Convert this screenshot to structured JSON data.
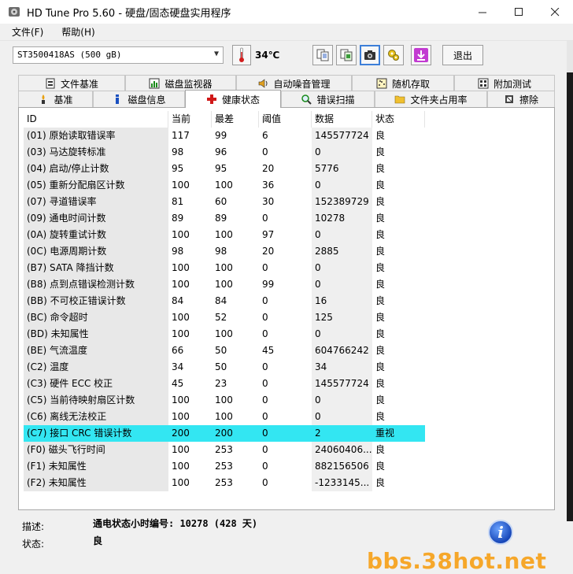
{
  "window": {
    "title": "HD Tune Pro 5.60 - 硬盘/固态硬盘实用程序",
    "minimize_icon": "minimize-icon",
    "maximize_icon": "maximize-icon",
    "close_icon": "close-icon"
  },
  "menu": [
    {
      "label": "文件(F)"
    },
    {
      "label": "帮助(H)"
    }
  ],
  "toolbar": {
    "drive": "ST3500418AS (500 gB)",
    "temperature": "34℃",
    "exit_label": "退出"
  },
  "tabs_top": [
    {
      "label": "文件基准",
      "icon": "file-benchmark-icon"
    },
    {
      "label": "磁盘监视器",
      "icon": "disk-monitor-icon"
    },
    {
      "label": "自动噪音管理",
      "icon": "speaker-icon"
    },
    {
      "label": "随机存取",
      "icon": "random-access-icon"
    },
    {
      "label": "附加测试",
      "icon": "extra-tests-icon"
    }
  ],
  "tabs_bottom": [
    {
      "label": "基准",
      "icon": "benchmark-icon"
    },
    {
      "label": "磁盘信息",
      "icon": "info-icon"
    },
    {
      "label": "健康状态",
      "icon": "health-cross-icon"
    },
    {
      "label": "错误扫描",
      "icon": "magnifier-icon"
    },
    {
      "label": "文件夹占用率",
      "icon": "folder-icon"
    },
    {
      "label": "擦除",
      "icon": "erase-icon"
    }
  ],
  "table": {
    "headers": [
      "ID",
      "当前",
      "最差",
      "阈值",
      "数据",
      "状态"
    ],
    "rows": [
      [
        "(01) 原始读取错误率",
        "117",
        "99",
        "6",
        "145577724",
        "良"
      ],
      [
        "(03) 马达旋转标准",
        "98",
        "96",
        "0",
        "0",
        "良"
      ],
      [
        "(04) 启动/停止计数",
        "95",
        "95",
        "20",
        "5776",
        "良"
      ],
      [
        "(05) 重新分配扇区计数",
        "100",
        "100",
        "36",
        "0",
        "良"
      ],
      [
        "(07) 寻道错误率",
        "81",
        "60",
        "30",
        "152389729",
        "良"
      ],
      [
        "(09) 通电时间计数",
        "89",
        "89",
        "0",
        "10278",
        "良"
      ],
      [
        "(0A) 旋转重试计数",
        "100",
        "100",
        "97",
        "0",
        "良"
      ],
      [
        "(0C) 电源周期计数",
        "98",
        "98",
        "20",
        "2885",
        "良"
      ],
      [
        "(B7) SATA 降挡计数",
        "100",
        "100",
        "0",
        "0",
        "良"
      ],
      [
        "(B8) 点到点错误检测计数",
        "100",
        "100",
        "99",
        "0",
        "良"
      ],
      [
        "(BB) 不可校正错误计数",
        "84",
        "84",
        "0",
        "16",
        "良"
      ],
      [
        "(BC) 命令超时",
        "100",
        "52",
        "0",
        "125",
        "良"
      ],
      [
        "(BD) 未知属性",
        "100",
        "100",
        "0",
        "0",
        "良"
      ],
      [
        "(BE) 气流温度",
        "66",
        "50",
        "45",
        "604766242",
        "良"
      ],
      [
        "(C2) 温度",
        "34",
        "50",
        "0",
        "34",
        "良"
      ],
      [
        "(C3) 硬件 ECC 校正",
        "45",
        "23",
        "0",
        "145577724",
        "良"
      ],
      [
        "(C5) 当前待映射扇区计数",
        "100",
        "100",
        "0",
        "0",
        "良"
      ],
      [
        "(C6) 离线无法校正",
        "100",
        "100",
        "0",
        "0",
        "良"
      ],
      [
        "(C7) 接口 CRC 错误计数",
        "200",
        "200",
        "0",
        "2",
        "重视"
      ],
      [
        "(F0) 磁头飞行时间",
        "100",
        "253",
        "0",
        "24060406...",
        "良"
      ],
      [
        "(F1) 未知属性",
        "100",
        "253",
        "0",
        "882156506",
        "良"
      ],
      [
        "(F2) 未知属性",
        "100",
        "253",
        "0",
        "-1233145...",
        "良"
      ]
    ],
    "warn_color": "#33e6f2"
  },
  "description": {
    "desc_label": "描述:",
    "desc_value": "通电状态小时编号: 10278 (428 天)",
    "status_label": "状态:",
    "status_value": "良"
  },
  "watermark": "bbs.38hot.net"
}
